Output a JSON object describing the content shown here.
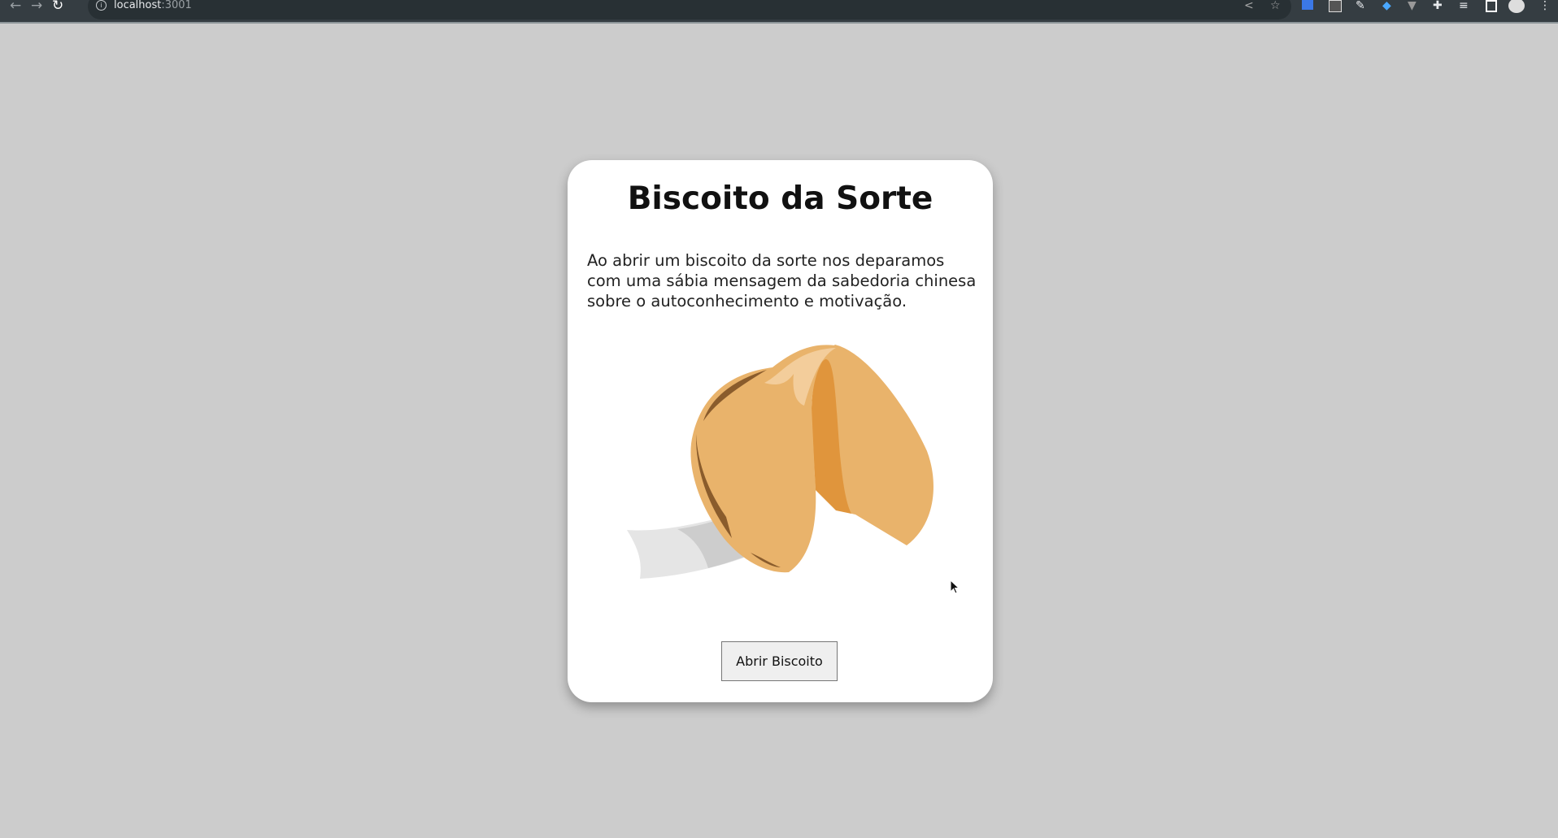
{
  "browser": {
    "url_host": "localhost",
    "url_port": ":3001",
    "toolbar_icons": [
      "back-icon",
      "forward-icon",
      "reload-icon",
      "info-icon",
      "share-icon",
      "star-icon",
      "translate-extension-icon",
      "extension-icon",
      "pen-extension-icon",
      "gem-extension-icon",
      "vue-extension-icon",
      "puzzle-icon",
      "media-icon",
      "sidebar-icon",
      "profile-avatar",
      "menu-icon"
    ]
  },
  "page": {
    "title": "Biscoito da Sorte",
    "description": "Ao abrir um biscoito da sorte nos deparamos com uma sábia mensagem da sabedoria chinesa sobre o autoconhecimento e motivação.",
    "button_label": "Abrir Biscoito"
  },
  "colors": {
    "background": "#cccccc",
    "cookie": "#e9b36b",
    "cookie_inner": "#e0953c",
    "cookie_dark": "#8a5c2c",
    "cookie_highlight": "#f3cd9b"
  }
}
